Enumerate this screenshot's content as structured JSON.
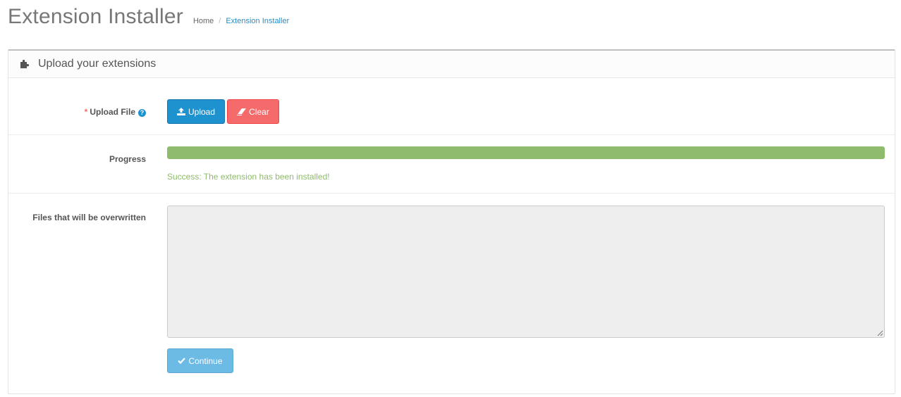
{
  "header": {
    "title": "Extension Installer",
    "breadcrumb": [
      {
        "label": "Home"
      },
      {
        "label": "Extension Installer"
      }
    ],
    "breadcrumb_separator": "/"
  },
  "panel": {
    "title": "Upload your extensions",
    "icon": "puzzle-piece-icon"
  },
  "upload_row": {
    "required_mark": "*",
    "label": "Upload File",
    "help_glyph": "?",
    "upload_label": "Upload",
    "clear_label": "Clear"
  },
  "progress_row": {
    "label": "Progress",
    "progress_percent": 100,
    "message": "Success: The extension has been installed!"
  },
  "overwrite_row": {
    "label": "Files that will be overwritten",
    "value": "",
    "continue_label": "Continue"
  },
  "colors": {
    "primary": "#1e91cf",
    "danger": "#f56b6b",
    "success": "#8fbb6c",
    "info": "#6cbbe5"
  }
}
